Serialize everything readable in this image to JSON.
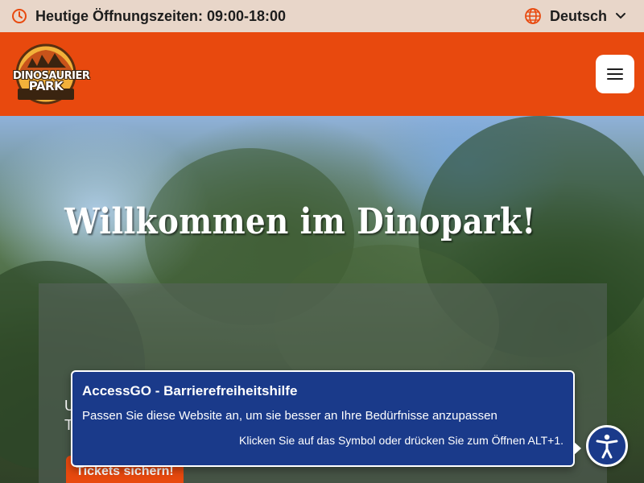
{
  "topbar": {
    "hours_label": "Heutige Öffnungszeiten: 09:00-18:00",
    "language": "Deutsch",
    "clock_icon": "clock-icon",
    "globe_icon": "globe-icon"
  },
  "header": {
    "logo_text_line1": "DINOSAURIER",
    "logo_text_line2": "PARK",
    "menu_icon": "hamburger-menu-icon"
  },
  "hero": {
    "title": "Willkommen im Dinopark!",
    "line1": "U",
    "line2": "T",
    "cta_label": "Tickets sichern!"
  },
  "a11y": {
    "title": "AccessGO - Barrierefreiheitshilfe",
    "description": "Passen Sie diese Website an, um sie besser an Ihre Bedürfnisse anzupassen",
    "hint": "Klicken Sie auf das Symbol oder drücken Sie zum Öffnen ALT+1.",
    "icon": "accessibility-icon"
  },
  "colors": {
    "brand_orange": "#e8490e",
    "topbar_bg": "#e8d6c9",
    "a11y_blue": "#1a3a8a"
  }
}
